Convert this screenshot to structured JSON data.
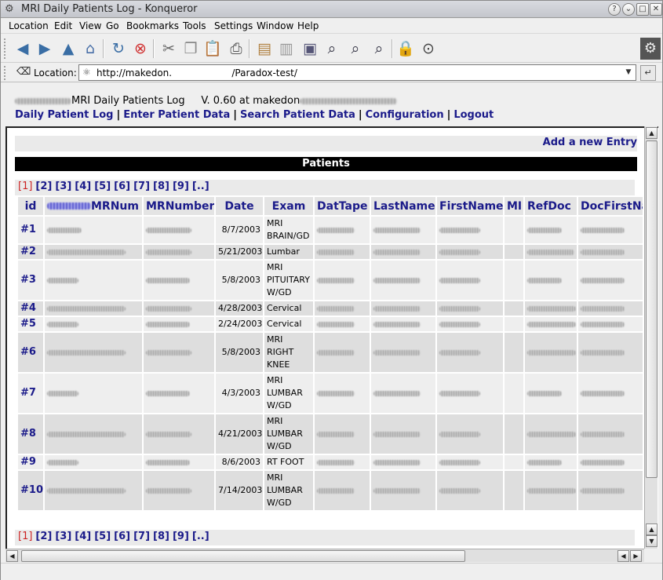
{
  "window": {
    "title": "MRI Daily Patients Log - Konqueror",
    "buttons": [
      "?",
      "⌄",
      "□",
      "✕"
    ]
  },
  "menu": {
    "items": [
      {
        "label": "Location"
      },
      {
        "label": "Edit"
      },
      {
        "label": "View"
      },
      {
        "label": "Go"
      },
      {
        "label": "Bookmarks"
      },
      {
        "label": "Tools"
      },
      {
        "label": "Settings"
      },
      {
        "label": "Window"
      },
      {
        "label": "Help"
      }
    ]
  },
  "toolbar": {
    "icons": [
      "back-icon",
      "forward-icon",
      "up-icon",
      "home-icon",
      "reload-icon",
      "stop-icon",
      "cut-icon",
      "copy-icon",
      "paste-icon",
      "print-icon",
      "new-folder-icon",
      "delete-icon",
      "find-icon",
      "zoom-icon",
      "zoom-in-icon",
      "zoom-out-icon",
      "lock-icon",
      "download-icon",
      "settings-gear-icon"
    ]
  },
  "location": {
    "label": "Location:",
    "url": "http://makedon.                    /Paradox-test/"
  },
  "header": {
    "title_main": "MRI Daily Patients Log",
    "version_text": "V. 0.60 at makedon",
    "nav": [
      {
        "label": "Daily Patient Log"
      },
      {
        "label": "Enter Patient Data"
      },
      {
        "label": "Search Patient Data"
      },
      {
        "label": "Configuration"
      },
      {
        "label": "Logout"
      }
    ]
  },
  "content": {
    "add_entry": "Add a new Entry",
    "section_title": "Patients",
    "pager_current": "[1]",
    "pager_links": [
      "[2]",
      "[3]",
      "[4]",
      "[5]",
      "[6]",
      "[7]",
      "[8]",
      "[9]",
      "[..]"
    ],
    "columns": [
      "id",
      "MRNum",
      "MRNumber",
      "Date",
      "Exam",
      "DatTape",
      "LastName",
      "FirstName",
      "MI",
      "RefDoc",
      "DocFirstNa"
    ],
    "rows": [
      {
        "id": "#1",
        "date": "8/7/2003",
        "exam": "MRI BRAIN/GD"
      },
      {
        "id": "#2",
        "date": "5/21/2003",
        "exam": "Lumbar"
      },
      {
        "id": "#3",
        "date": "5/8/2003",
        "exam": "MRI PITUITARY W/GD"
      },
      {
        "id": "#4",
        "date": "4/28/2003",
        "exam": "Cervical"
      },
      {
        "id": "#5",
        "date": "2/24/2003",
        "exam": "Cervical"
      },
      {
        "id": "#6",
        "date": "5/8/2003",
        "exam": "MRI RIGHT KNEE"
      },
      {
        "id": "#7",
        "date": "4/3/2003",
        "exam": "MRI LUMBAR W/GD"
      },
      {
        "id": "#8",
        "date": "4/21/2003",
        "exam": "MRI LUMBAR W/GD"
      },
      {
        "id": "#9",
        "date": "8/6/2003",
        "exam": "RT FOOT"
      },
      {
        "id": "#10",
        "date": "7/14/2003",
        "exam": "MRI LUMBAR W/GD"
      }
    ]
  }
}
